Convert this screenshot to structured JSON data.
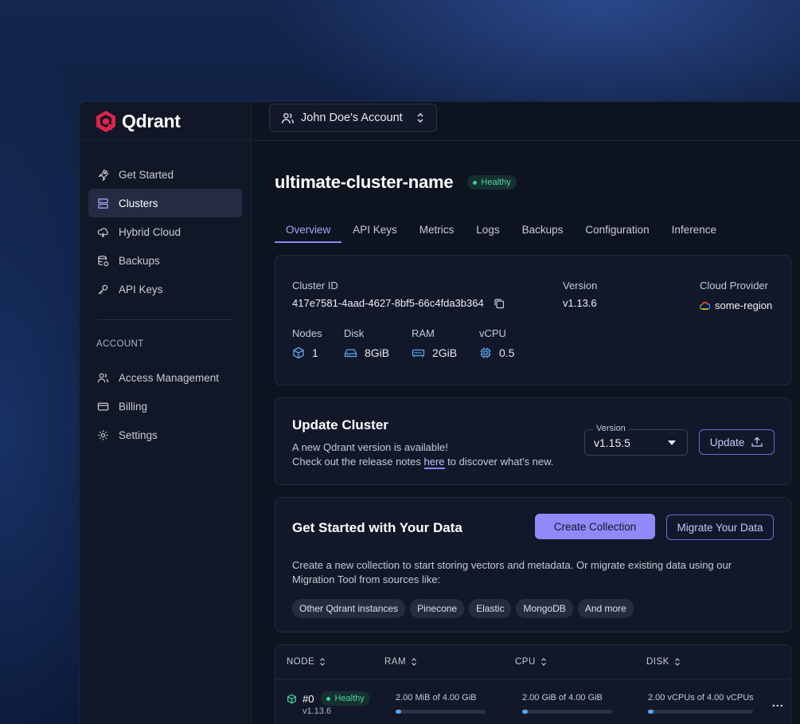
{
  "app": {
    "name": "Qdrant"
  },
  "account": {
    "name": "John Doe's Account"
  },
  "sidebar": {
    "items": [
      {
        "label": "Get Started",
        "icon": "rocket-icon"
      },
      {
        "label": "Clusters",
        "icon": "server-icon",
        "active": true
      },
      {
        "label": "Hybrid Cloud",
        "icon": "cloud-icon"
      },
      {
        "label": "Backups",
        "icon": "database-backup-icon"
      },
      {
        "label": "API Keys",
        "icon": "key-icon"
      }
    ],
    "account_section": "ACCOUNT",
    "account_items": [
      {
        "label": "Access Management",
        "icon": "users-icon"
      },
      {
        "label": "Billing",
        "icon": "credit-card-icon"
      },
      {
        "label": "Settings",
        "icon": "gear-icon"
      }
    ]
  },
  "cluster": {
    "name": "ultimate-cluster-name",
    "status": "Healthy",
    "id_label": "Cluster ID",
    "id": "417e7581-4aad-4627-8bf5-66c4fda3b364",
    "version_label": "Version",
    "version": "v1.13.6",
    "provider_label": "Cloud Provider",
    "region": "some-region",
    "nodes_label": "Nodes",
    "nodes": "1",
    "disk_label": "Disk",
    "disk": "8GiB",
    "ram_label": "RAM",
    "ram": "2GiB",
    "vcpu_label": "vCPU",
    "vcpu": "0.5"
  },
  "tabs": [
    "Overview",
    "API Keys",
    "Metrics",
    "Logs",
    "Backups",
    "Configuration",
    "Inference"
  ],
  "update": {
    "title": "Update Cluster",
    "line1": "A new Qdrant version is available!",
    "line2_pre": "Check out the release notes ",
    "line2_link": "here",
    "line2_post": " to discover what's new.",
    "version_legend": "Version",
    "version_value": "v1.15.5",
    "button": "Update"
  },
  "get_started": {
    "title": "Get Started with Your Data",
    "create_button": "Create Collection",
    "migrate_button": "Migrate Your Data",
    "description": "Create a new collection to start storing vectors and metadata. Or migrate existing data using our Migration Tool from sources like:",
    "sources": [
      "Other Qdrant instances",
      "Pinecone",
      "Elastic",
      "MongoDB",
      "And more"
    ]
  },
  "nodes_table": {
    "headers": [
      "NODE",
      "RAM",
      "CPU",
      "DISK"
    ],
    "rows": [
      {
        "node": "#0",
        "status": "Healthy",
        "version": "v1.13.6",
        "ram": "2.00 MiB of 4.00 GiB",
        "cpu": "2.00 GiB of 4.00 GiB",
        "disk": "2.00 vCPUs of 4.00 vCPUs",
        "menu": "..."
      }
    ]
  }
}
